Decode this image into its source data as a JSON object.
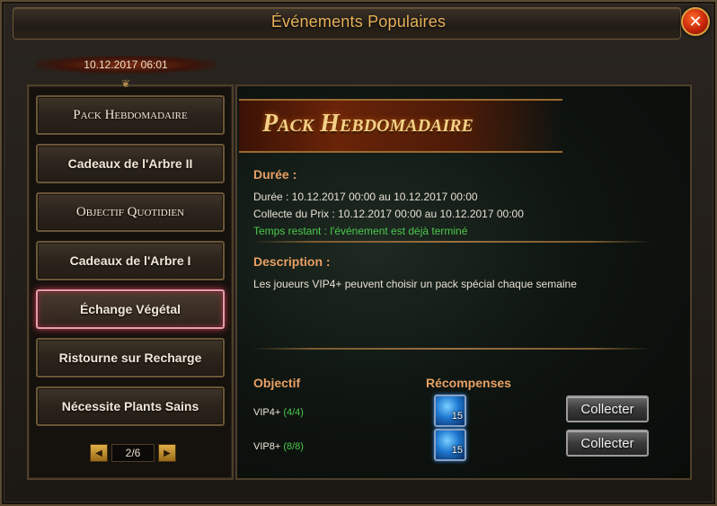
{
  "window": {
    "title": "Événements Populaires",
    "close_label": "✕",
    "datestamp": "10.12.2017 06:01"
  },
  "sidebar": {
    "items": [
      {
        "label": "Pack Hebdomadaire"
      },
      {
        "label": "Cadeaux de l'Arbre II"
      },
      {
        "label": "Objectif Quotidien"
      },
      {
        "label": "Cadeaux de l'Arbre I"
      },
      {
        "label": "Échange Végétal"
      },
      {
        "label": "Ristourne sur Recharge"
      },
      {
        "label": "Nécessite Plants Sains"
      }
    ],
    "active_index": 4,
    "pager": {
      "text": "2/6",
      "prev_icon": "◀",
      "next_icon": "▶"
    }
  },
  "main": {
    "banner_title": "Pack Hebdomadaire",
    "duration_heading": "Durée :",
    "duration_line": "Durée : 10.12.2017 00:00 au 10.12.2017 00:00",
    "collect_line": "Collecte du Prix : 10.12.2017 00:00 au 10.12.2017 00:00",
    "remaining_line": "Temps restant : l'événement est déjà terminé",
    "description_heading": "Description :",
    "description_text": "Les joueurs VIP4+ peuvent choisir un pack spécial chaque semaine",
    "objective_heading": "Objectif",
    "rewards_heading": "Récompenses",
    "rows": [
      {
        "objective": "VIP4+",
        "progress": "(4/4)",
        "reward_count": "15",
        "button": "Collecter"
      },
      {
        "objective": "VIP8+",
        "progress": "(8/8)",
        "reward_count": "15",
        "button": "Collecter"
      }
    ]
  },
  "colors": {
    "title_gold": "#e8b05a",
    "heading_orange": "#e8a064",
    "status_green": "#4cc84c",
    "close_red": "#c8260a"
  }
}
